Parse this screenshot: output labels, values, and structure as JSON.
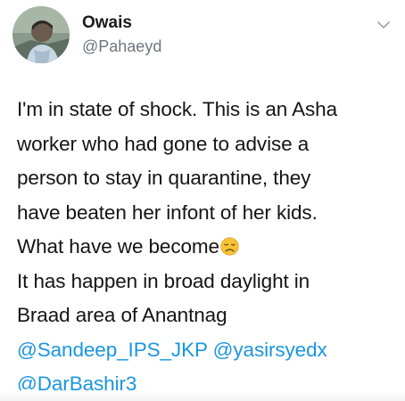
{
  "author": {
    "name": "Owais",
    "handle": "@Pahaeyd"
  },
  "tweet": {
    "lines": [
      "I'm in state of shock. This is an Asha",
      "worker who had gone to advise a",
      "person to stay in quarantine, they",
      "have beaten her infont of her kids.",
      "What have we become",
      "It has happen in broad daylight in",
      "Braad area of Anantnag"
    ],
    "mentions": [
      "@Sandeep_IPS_JKP",
      "@yasirsyedx",
      "@DarBashir3"
    ],
    "emoji": "disappointed-face-emoji"
  },
  "icons": {
    "more_menu": "chevron-down-icon"
  },
  "colors": {
    "text": "#141414",
    "handle": "#6e767d",
    "mention": "#1b95e0",
    "emoji": "#f7c236"
  }
}
